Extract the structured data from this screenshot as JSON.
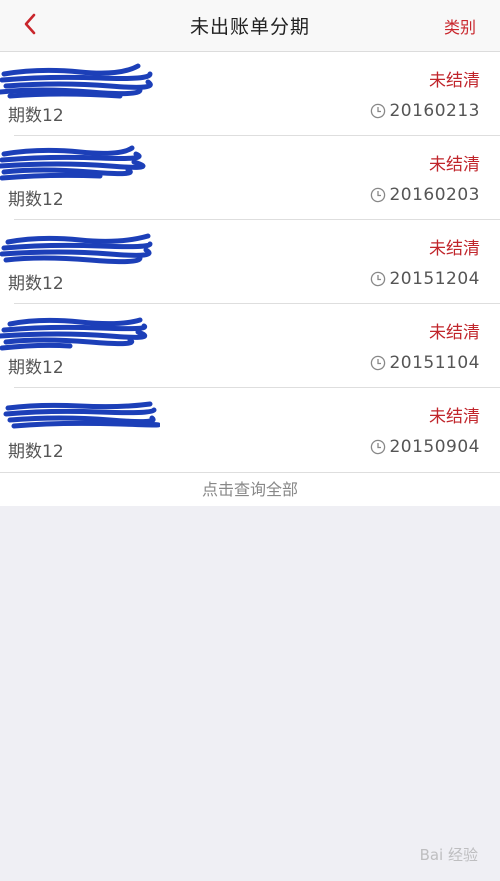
{
  "nav": {
    "title": "未出账单分期",
    "right_label": "类别",
    "back_icon": "chevron-left-icon",
    "accent": "#c9262c"
  },
  "list": {
    "items": [
      {
        "status": "未结清",
        "period": "期数12",
        "date": "20160213"
      },
      {
        "status": "未结清",
        "period": "期数12",
        "date": "20160203"
      },
      {
        "status": "未结清",
        "period": "期数12",
        "date": "20151204"
      },
      {
        "status": "未结清",
        "period": "期数12",
        "date": "20151104"
      },
      {
        "status": "未结清",
        "period": "期数12",
        "date": "20150904"
      }
    ]
  },
  "footer": {
    "query_all": "点击查询全部"
  },
  "watermark": {
    "text": "Bai 经验"
  }
}
